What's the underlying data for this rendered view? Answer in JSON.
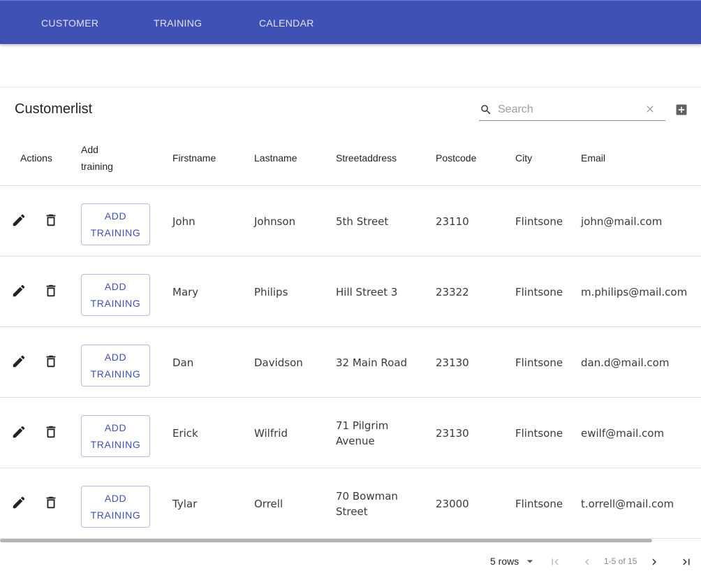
{
  "nav": {
    "tabs": [
      {
        "label": "CUSTOMER"
      },
      {
        "label": "TRAINING"
      },
      {
        "label": "CALENDAR"
      }
    ]
  },
  "table": {
    "title": "Customerlist",
    "search": {
      "placeholder": "Search",
      "value": ""
    },
    "columns": [
      "Actions",
      "Add training",
      "Firstname",
      "Lastname",
      "Streetaddress",
      "Postcode",
      "City",
      "Email"
    ],
    "add_training_label": "ADD TRAINING",
    "rows": [
      {
        "firstname": "John",
        "lastname": "Johnson",
        "street": "5th Street",
        "postcode": "23110",
        "city": "Flintsone",
        "email": "john@mail.com"
      },
      {
        "firstname": "Mary",
        "lastname": "Philips",
        "street": "Hill Street 3",
        "postcode": "23322",
        "city": "Flintsone",
        "email": "m.philips@mail.com"
      },
      {
        "firstname": "Dan",
        "lastname": "Davidson",
        "street": "32 Main Road",
        "postcode": "23130",
        "city": "Flintsone",
        "email": "dan.d@mail.com"
      },
      {
        "firstname": "Erick",
        "lastname": "Wilfrid",
        "street": "71 Pilgrim Avenue",
        "postcode": "23130",
        "city": "Flintsone",
        "email": "ewilf@mail.com"
      },
      {
        "firstname": "Tylar",
        "lastname": "Orrell",
        "street": "70 Bowman Street",
        "postcode": "23000",
        "city": "Flintsone",
        "email": "t.orrell@mail.com"
      }
    ]
  },
  "pagination": {
    "rows_per_page": "5 rows",
    "range": "1-5 of 15"
  },
  "colors": {
    "primary": "#3f51b5",
    "nav_text": "#dfe3f6"
  },
  "icons": [
    "search-icon",
    "clear-icon",
    "add-box-icon",
    "edit-icon",
    "delete-icon",
    "dropdown-icon",
    "first-page-icon",
    "prev-page-icon",
    "next-page-icon",
    "last-page-icon"
  ]
}
